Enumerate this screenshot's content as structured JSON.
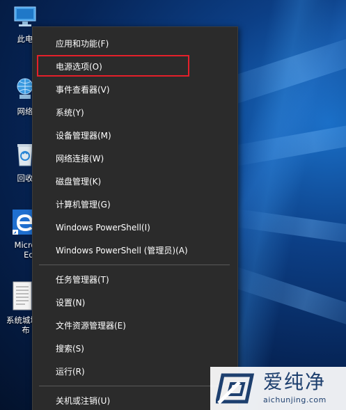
{
  "desktop_icons": [
    {
      "id": "this-pc",
      "label": "此电"
    },
    {
      "id": "network",
      "label": "网络"
    },
    {
      "id": "recycle-bin",
      "label": "回收"
    },
    {
      "id": "edge",
      "label_line1": "Micro",
      "label_line2": "Edg"
    },
    {
      "id": "document",
      "label_line1": "系统城城",
      "label_line2": "布"
    }
  ],
  "menu": {
    "items": [
      {
        "label": "应用和功能(F)"
      },
      {
        "label": "电源选项(O)"
      },
      {
        "label": "事件查看器(V)"
      },
      {
        "label": "系统(Y)"
      },
      {
        "label": "设备管理器(M)"
      },
      {
        "label": "网络连接(W)"
      },
      {
        "label": "磁盘管理(K)"
      },
      {
        "label": "计算机管理(G)"
      },
      {
        "label": "Windows PowerShell(I)"
      },
      {
        "label": "Windows PowerShell (管理员)(A)"
      },
      {
        "label": "任务管理器(T)"
      },
      {
        "label": "设置(N)"
      },
      {
        "label": "文件资源管理器(E)"
      },
      {
        "label": "搜索(S)"
      },
      {
        "label": "运行(R)"
      },
      {
        "label": "关机或注销(U)"
      }
    ],
    "highlighted_item": "电源选项(O)",
    "highlight_color": "#e5202a",
    "background_color": "#2b2b2b"
  },
  "watermark": {
    "title": "爱纯净",
    "url": "aichunjing.com"
  }
}
